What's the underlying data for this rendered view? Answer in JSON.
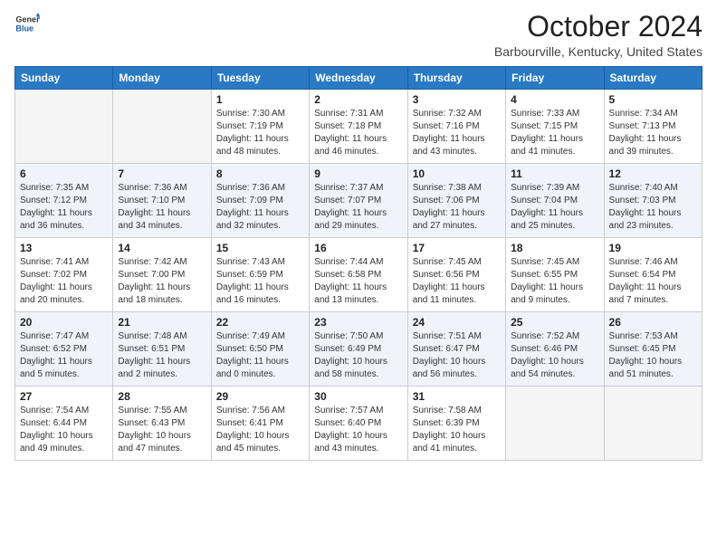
{
  "header": {
    "logo": {
      "line1": "General",
      "line2": "Blue"
    },
    "title": "October 2024",
    "subtitle": "Barbourville, Kentucky, United States"
  },
  "weekdays": [
    "Sunday",
    "Monday",
    "Tuesday",
    "Wednesday",
    "Thursday",
    "Friday",
    "Saturday"
  ],
  "weeks": [
    [
      {
        "day": "",
        "info": ""
      },
      {
        "day": "",
        "info": ""
      },
      {
        "day": "1",
        "info": "Sunrise: 7:30 AM\nSunset: 7:19 PM\nDaylight: 11 hours and 48 minutes."
      },
      {
        "day": "2",
        "info": "Sunrise: 7:31 AM\nSunset: 7:18 PM\nDaylight: 11 hours and 46 minutes."
      },
      {
        "day": "3",
        "info": "Sunrise: 7:32 AM\nSunset: 7:16 PM\nDaylight: 11 hours and 43 minutes."
      },
      {
        "day": "4",
        "info": "Sunrise: 7:33 AM\nSunset: 7:15 PM\nDaylight: 11 hours and 41 minutes."
      },
      {
        "day": "5",
        "info": "Sunrise: 7:34 AM\nSunset: 7:13 PM\nDaylight: 11 hours and 39 minutes."
      }
    ],
    [
      {
        "day": "6",
        "info": "Sunrise: 7:35 AM\nSunset: 7:12 PM\nDaylight: 11 hours and 36 minutes."
      },
      {
        "day": "7",
        "info": "Sunrise: 7:36 AM\nSunset: 7:10 PM\nDaylight: 11 hours and 34 minutes."
      },
      {
        "day": "8",
        "info": "Sunrise: 7:36 AM\nSunset: 7:09 PM\nDaylight: 11 hours and 32 minutes."
      },
      {
        "day": "9",
        "info": "Sunrise: 7:37 AM\nSunset: 7:07 PM\nDaylight: 11 hours and 29 minutes."
      },
      {
        "day": "10",
        "info": "Sunrise: 7:38 AM\nSunset: 7:06 PM\nDaylight: 11 hours and 27 minutes."
      },
      {
        "day": "11",
        "info": "Sunrise: 7:39 AM\nSunset: 7:04 PM\nDaylight: 11 hours and 25 minutes."
      },
      {
        "day": "12",
        "info": "Sunrise: 7:40 AM\nSunset: 7:03 PM\nDaylight: 11 hours and 23 minutes."
      }
    ],
    [
      {
        "day": "13",
        "info": "Sunrise: 7:41 AM\nSunset: 7:02 PM\nDaylight: 11 hours and 20 minutes."
      },
      {
        "day": "14",
        "info": "Sunrise: 7:42 AM\nSunset: 7:00 PM\nDaylight: 11 hours and 18 minutes."
      },
      {
        "day": "15",
        "info": "Sunrise: 7:43 AM\nSunset: 6:59 PM\nDaylight: 11 hours and 16 minutes."
      },
      {
        "day": "16",
        "info": "Sunrise: 7:44 AM\nSunset: 6:58 PM\nDaylight: 11 hours and 13 minutes."
      },
      {
        "day": "17",
        "info": "Sunrise: 7:45 AM\nSunset: 6:56 PM\nDaylight: 11 hours and 11 minutes."
      },
      {
        "day": "18",
        "info": "Sunrise: 7:45 AM\nSunset: 6:55 PM\nDaylight: 11 hours and 9 minutes."
      },
      {
        "day": "19",
        "info": "Sunrise: 7:46 AM\nSunset: 6:54 PM\nDaylight: 11 hours and 7 minutes."
      }
    ],
    [
      {
        "day": "20",
        "info": "Sunrise: 7:47 AM\nSunset: 6:52 PM\nDaylight: 11 hours and 5 minutes."
      },
      {
        "day": "21",
        "info": "Sunrise: 7:48 AM\nSunset: 6:51 PM\nDaylight: 11 hours and 2 minutes."
      },
      {
        "day": "22",
        "info": "Sunrise: 7:49 AM\nSunset: 6:50 PM\nDaylight: 11 hours and 0 minutes."
      },
      {
        "day": "23",
        "info": "Sunrise: 7:50 AM\nSunset: 6:49 PM\nDaylight: 10 hours and 58 minutes."
      },
      {
        "day": "24",
        "info": "Sunrise: 7:51 AM\nSunset: 6:47 PM\nDaylight: 10 hours and 56 minutes."
      },
      {
        "day": "25",
        "info": "Sunrise: 7:52 AM\nSunset: 6:46 PM\nDaylight: 10 hours and 54 minutes."
      },
      {
        "day": "26",
        "info": "Sunrise: 7:53 AM\nSunset: 6:45 PM\nDaylight: 10 hours and 51 minutes."
      }
    ],
    [
      {
        "day": "27",
        "info": "Sunrise: 7:54 AM\nSunset: 6:44 PM\nDaylight: 10 hours and 49 minutes."
      },
      {
        "day": "28",
        "info": "Sunrise: 7:55 AM\nSunset: 6:43 PM\nDaylight: 10 hours and 47 minutes."
      },
      {
        "day": "29",
        "info": "Sunrise: 7:56 AM\nSunset: 6:41 PM\nDaylight: 10 hours and 45 minutes."
      },
      {
        "day": "30",
        "info": "Sunrise: 7:57 AM\nSunset: 6:40 PM\nDaylight: 10 hours and 43 minutes."
      },
      {
        "day": "31",
        "info": "Sunrise: 7:58 AM\nSunset: 6:39 PM\nDaylight: 10 hours and 41 minutes."
      },
      {
        "day": "",
        "info": ""
      },
      {
        "day": "",
        "info": ""
      }
    ]
  ]
}
